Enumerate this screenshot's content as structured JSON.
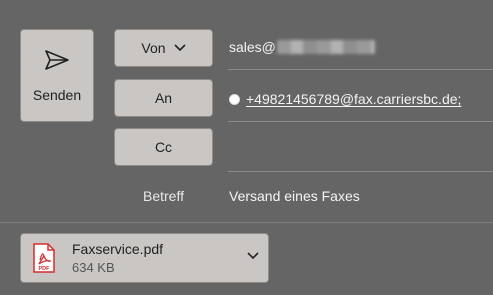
{
  "compose": {
    "send_label": "Senden",
    "from_button_label": "Von",
    "to_button_label": "An",
    "cc_button_label": "Cc",
    "from_address_visible": "sales@",
    "to_recipient": "+49821456789@fax.carriersbc.de;",
    "subject_label": "Betreff",
    "subject_value": "Versand eines Faxes"
  },
  "attachment": {
    "file_name": "Faxservice.pdf",
    "file_size": "634 KB",
    "icon_text": "PDF"
  },
  "icons": {
    "send": "paper-plane-icon",
    "from_dropdown": "chevron-down-icon",
    "attachment_file": "pdf-file-icon",
    "attachment_menu": "chevron-down-icon",
    "recipient_status": "presence-dot-icon"
  },
  "colors": {
    "background": "#656565",
    "button": "#c9c6c3",
    "pdf_red": "#d32f2f"
  }
}
